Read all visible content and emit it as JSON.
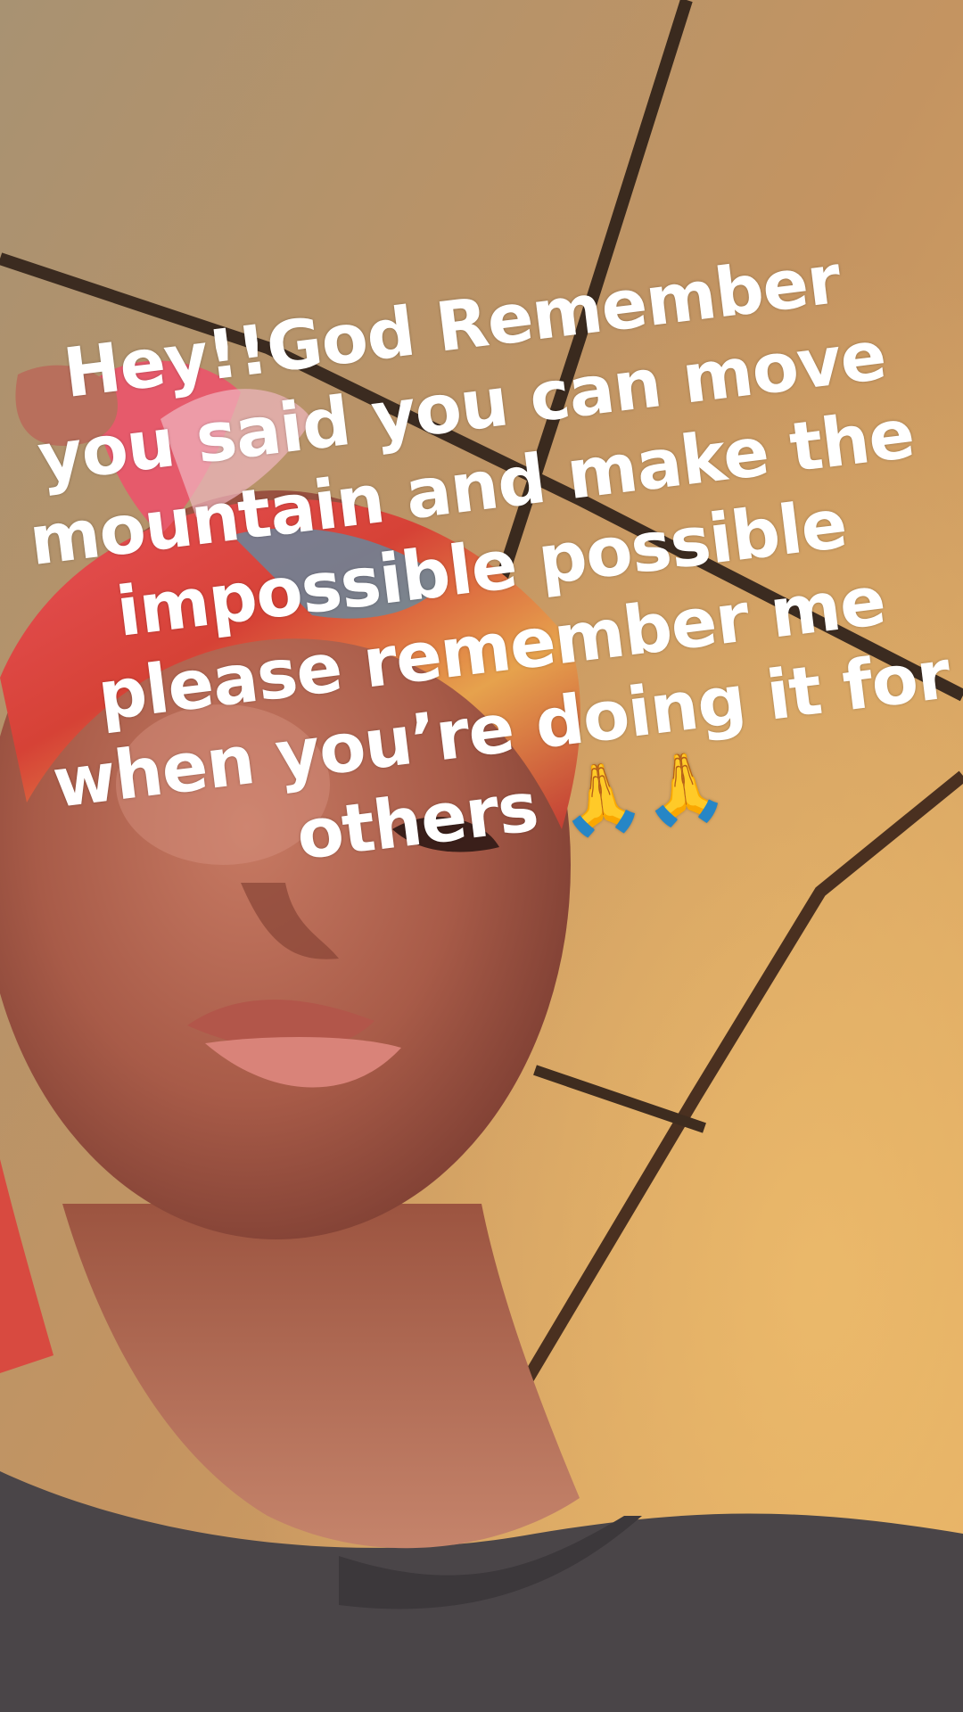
{
  "caption": {
    "lines": [
      "Hey!!God Remember",
      "you said you can move",
      "mountain and make the",
      "impossible possible",
      "please remember me",
      "when you’re doing it for",
      "others"
    ],
    "emoji": "🙏🙏",
    "emoji_name": "praying-hands-icon"
  },
  "colors": {
    "text": "#ffffff",
    "headwrap_red": "#d8453c",
    "wall": "#dfa860",
    "shirt": "#4a4548"
  }
}
